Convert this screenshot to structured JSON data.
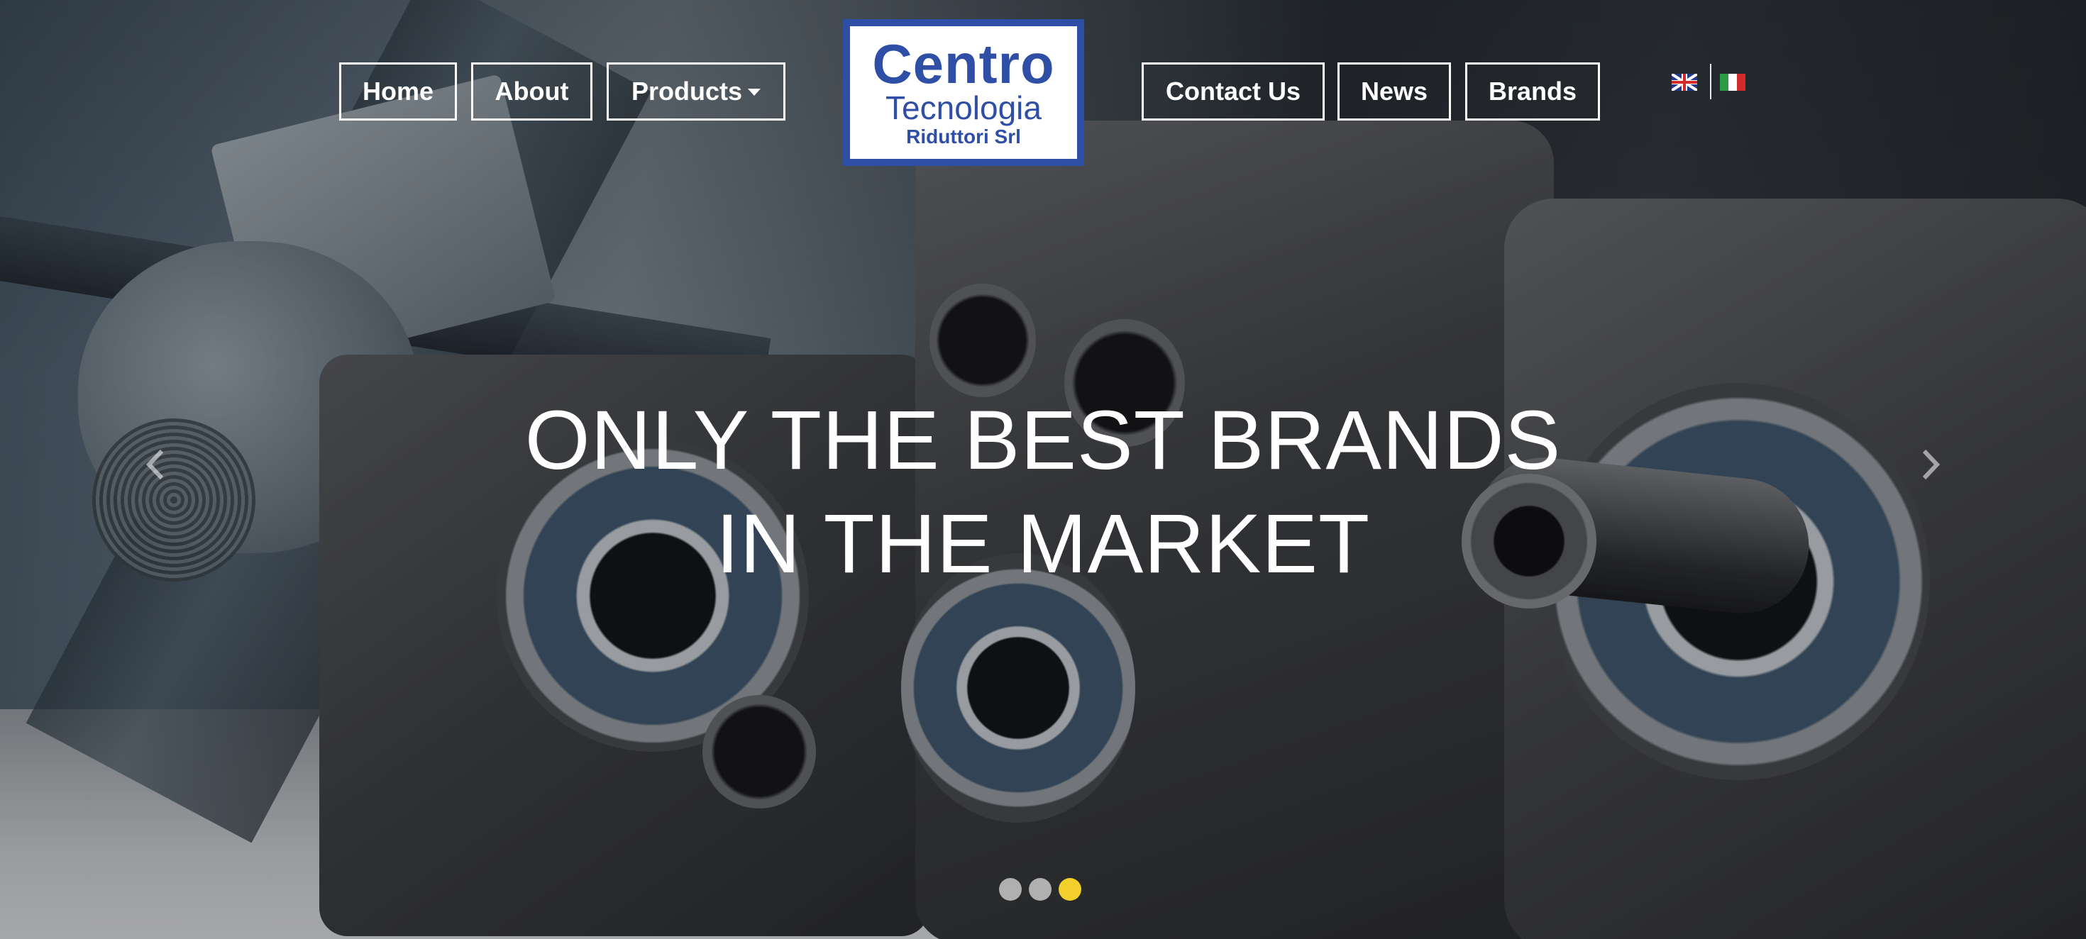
{
  "nav": {
    "left": [
      {
        "label": "Home"
      },
      {
        "label": "About"
      },
      {
        "label": "Products"
      }
    ],
    "right": [
      {
        "label": "Contact Us"
      },
      {
        "label": "News"
      },
      {
        "label": "Brands"
      }
    ]
  },
  "logo": {
    "line1": "Centro",
    "line2": "Tecnologia",
    "line3": "Riduttori Srl",
    "brand_color": "#2f4fa6"
  },
  "languages": [
    {
      "icon": "uk-flag-icon"
    },
    {
      "icon": "italy-flag-icon"
    }
  ],
  "slider": {
    "headline_line1": "ONLY THE BEST BRANDS",
    "headline_line2": "IN THE MARKET",
    "slide_count": 3,
    "active_slide": 3,
    "prev_icon": "chevron-left-icon",
    "next_icon": "chevron-right-icon",
    "active_dot_color": "#f2cf2a"
  }
}
